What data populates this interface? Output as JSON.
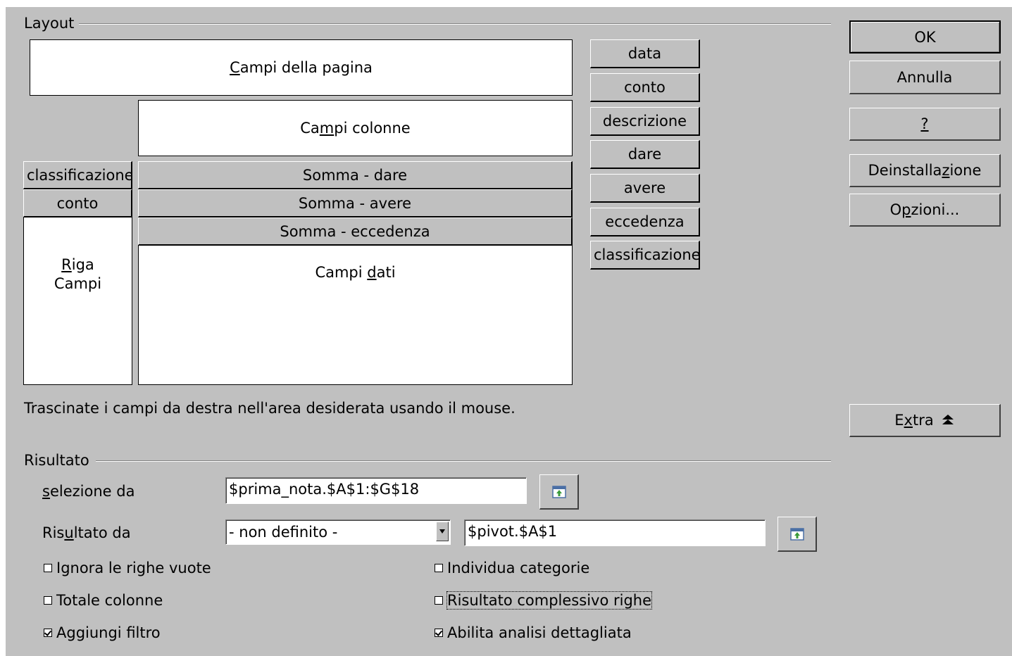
{
  "layout": {
    "group_label": "Layout",
    "page_fields": {
      "pre": "",
      "mn": "C",
      "post": "ampi della pagina"
    },
    "column_fields": {
      "pre": "Ca",
      "mn": "m",
      "post": "pi colonne"
    },
    "row_fields_line1": {
      "pre": "",
      "mn": "R",
      "post": "iga"
    },
    "row_fields_line2": "Campi",
    "data_fields": {
      "pre": "Campi ",
      "mn": "d",
      "post": "ati"
    },
    "row_items": [
      "classificazione",
      "conto"
    ],
    "data_items": [
      "Somma - dare",
      "Somma - avere",
      "Somma - eccedenza"
    ],
    "available_fields": [
      "data",
      "conto",
      "descrizione",
      "dare",
      "avere",
      "eccedenza",
      "classificazione"
    ],
    "hint": "Trascinate i campi da destra nell'area desiderata usando il mouse."
  },
  "buttons": {
    "ok": "OK",
    "cancel": "Annulla",
    "help": "?",
    "remove": {
      "pre": "Deinstalla",
      "mn": "z",
      "post": "ione"
    },
    "options": {
      "pre": "O",
      "mn": "p",
      "post": "zioni..."
    },
    "extra": {
      "pre": "E",
      "mn": "x",
      "post": "tra"
    }
  },
  "result": {
    "group_label": "Risultato",
    "selection_label": {
      "pre": "",
      "mn": "s",
      "post": "elezione da"
    },
    "selection_value": "$prima_nota.$A$1:$G$18",
    "output_label": {
      "pre": "Ris",
      "mn": "u",
      "post": "ltato da"
    },
    "output_select": "- non definito -",
    "output_value": "$pivot.$A$1",
    "options": {
      "ignore_empty_rows": {
        "label": "Ignora le righe vuote",
        "checked": false
      },
      "identify_categories": {
        "label": "Individua categorie",
        "checked": false
      },
      "total_columns": {
        "label": "Totale colonne",
        "checked": false
      },
      "total_rows": {
        "label": "Risultato complessivo righe",
        "checked": false
      },
      "add_filter": {
        "label": "Aggiungi filtro",
        "checked": true
      },
      "enable_drilldown": {
        "label": "Abilita analisi dettagliata",
        "checked": true
      }
    }
  },
  "icons": {
    "shrink": "shrink-selector-icon",
    "extra": "collapse-up-icon",
    "dropdown": "dropdown-arrow-icon"
  }
}
